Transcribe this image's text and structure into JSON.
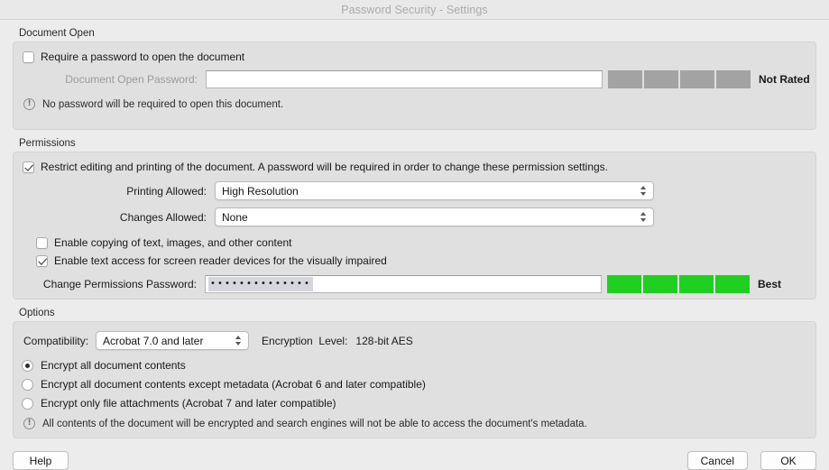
{
  "window": {
    "title": "Password Security - Settings"
  },
  "document_open": {
    "group_label": "Document Open",
    "require_password_checkbox": "Require a password to open the document",
    "require_password_checked": false,
    "password_label": "Document Open Password:",
    "password_value": "",
    "password_placeholder": "",
    "strength_label": "Not Rated",
    "strength_blocks": 4,
    "strength_filled": 0,
    "strength_color": "#a3a3a3",
    "warning": "No password will be required to open this document.",
    "warning_icon": "exclamation-circle-icon"
  },
  "permissions": {
    "group_label": "Permissions",
    "restrict_checkbox": "Restrict editing and printing of the document. A password will be required in order to change these permission settings.",
    "restrict_checked": true,
    "printing_label": "Printing Allowed:",
    "printing_value": "High Resolution",
    "changes_label": "Changes Allowed:",
    "changes_value": "None",
    "copy_checkbox": "Enable copying of text, images, and other content",
    "copy_checked": false,
    "screenreader_checkbox": "Enable text access for screen reader devices for the visually impaired",
    "screenreader_checked": true,
    "perm_password_label": "Change Permissions Password:",
    "perm_password_value": "••••••••••••••",
    "perm_strength_label": "Best",
    "perm_strength_blocks": 4,
    "perm_strength_color": "#20d020"
  },
  "options": {
    "group_label": "Options",
    "compatibility_label": "Compatibility:",
    "compatibility_value": "Acrobat 7.0 and later",
    "encryption_level_label": "Encryption  Level:",
    "encryption_level_value": "128-bit AES",
    "radios": [
      {
        "label": "Encrypt all document contents",
        "selected": true
      },
      {
        "label": "Encrypt all document contents except metadata (Acrobat 6 and later compatible)",
        "selected": false
      },
      {
        "label": "Encrypt only file attachments (Acrobat 7 and later compatible)",
        "selected": false
      }
    ],
    "warning": "All contents of the document will be encrypted and search engines will not be able to access the document's metadata.",
    "warning_icon": "exclamation-circle-icon"
  },
  "footer": {
    "help_label": "Help",
    "cancel_label": "Cancel",
    "ok_label": "OK"
  }
}
